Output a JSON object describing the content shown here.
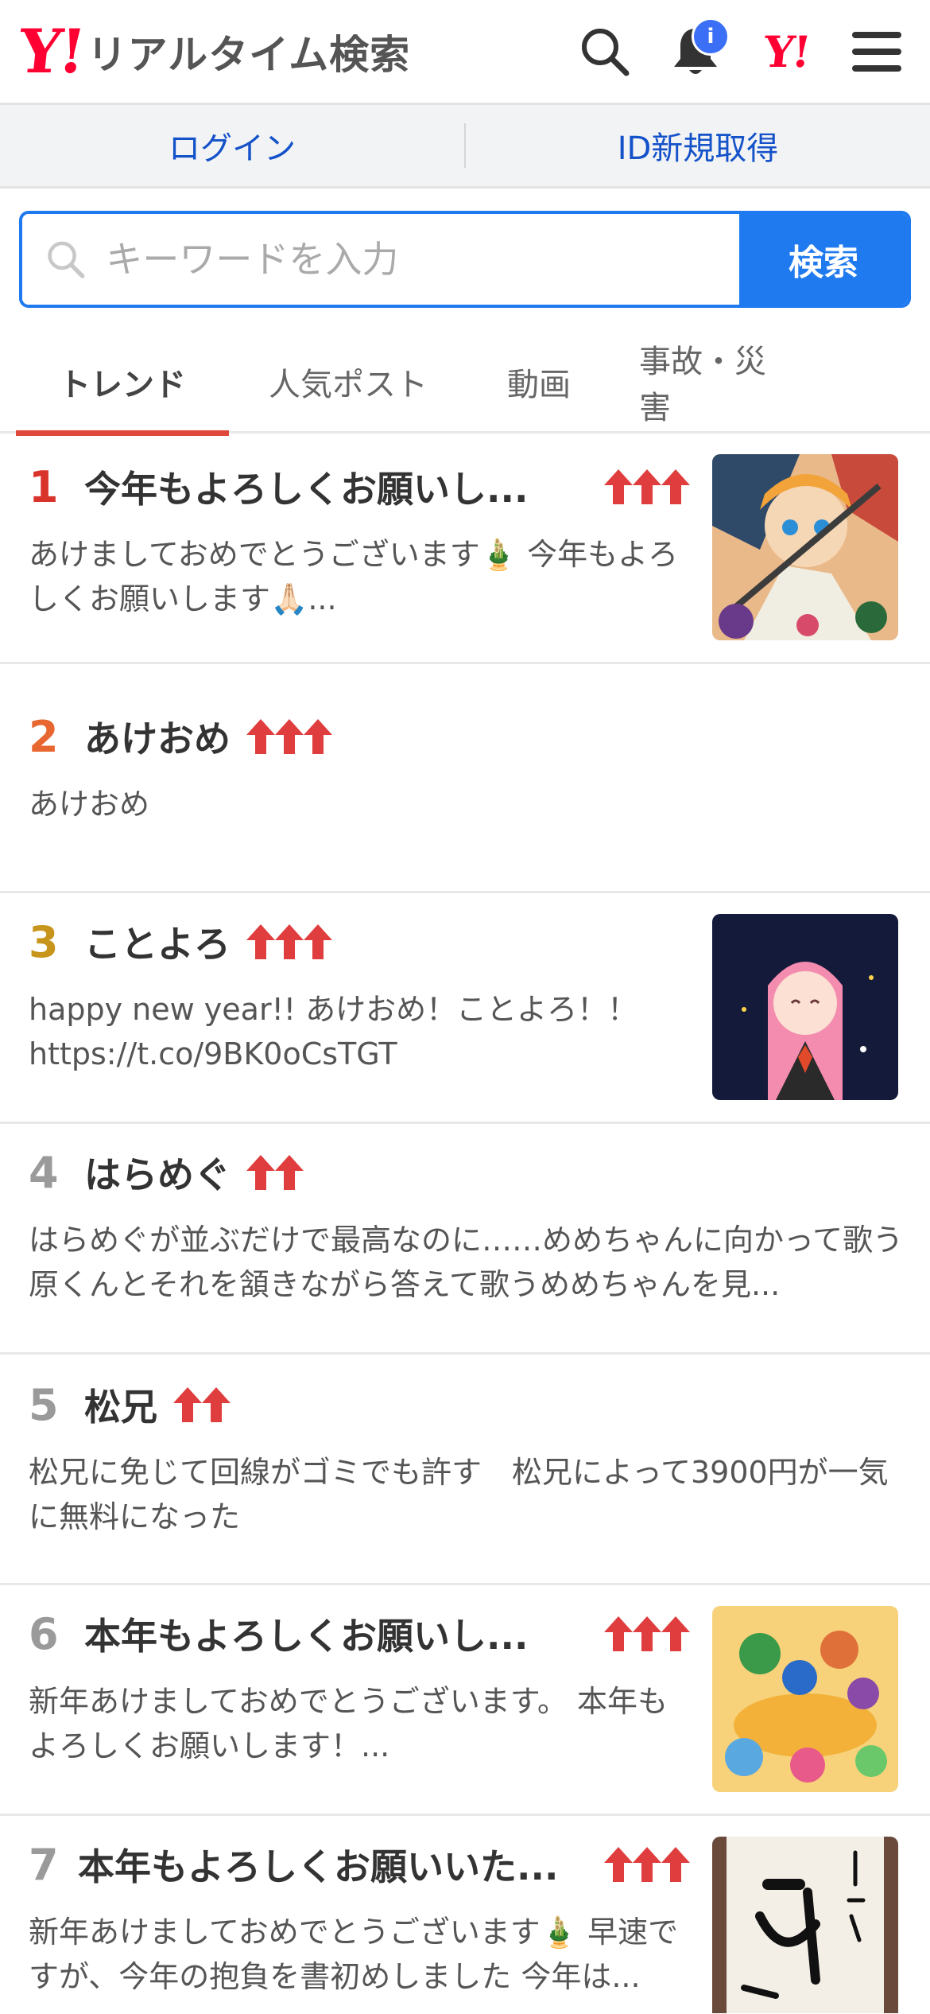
{
  "header": {
    "logo_y": "Y!",
    "logo_text": "リアルタイム検索",
    "notification_badge": "i",
    "yahoo_mini": "Y!"
  },
  "login_bar": {
    "login": "ログイン",
    "signup": "ID新規取得"
  },
  "search": {
    "placeholder": "キーワードを入力",
    "button": "検索"
  },
  "tabs": [
    {
      "label": "トレンド",
      "active": true
    },
    {
      "label": "人気ポスト",
      "active": false
    },
    {
      "label": "動画",
      "active": false
    },
    {
      "label": "事故・災害",
      "active": false
    }
  ],
  "colors": {
    "rank_1": "#d9342b",
    "rank_2": "#e8662f",
    "rank_3": "#c8951c",
    "rank_other": "#9a9a9a",
    "arrow": "#e03e3e",
    "accent_blue": "#1f7af0"
  },
  "trends": [
    {
      "rank": "1",
      "title": "今年もよろしくお願いし...",
      "arrows": 3,
      "desc": "あけましておめでとうございます🎍 今年もよろしくお願いします🙏🏻...",
      "thumb": "anime-illustration"
    },
    {
      "rank": "2",
      "title": "あけおめ",
      "arrows": 3,
      "desc": "あけおめ"
    },
    {
      "rank": "3",
      "title": "ことよろ",
      "arrows": 3,
      "desc": "happy new year!! あけおめ！ことよろ！！ https://t.co/9BK0oCsTGT",
      "thumb": "happy-new-year-illustration"
    },
    {
      "rank": "4",
      "title": "はらめぐ",
      "arrows": 2,
      "desc": "はらめぐが並ぶだけで最高なのに……めめちゃんに向かって歌う原くんとそれを頷きながら答えて歌うめめちゃんを見..."
    },
    {
      "rank": "5",
      "title": "松兄",
      "arrows": 2,
      "desc": "松兄に免じて回線がゴミでも許す　松兄によって3900円が一気に無料になった"
    },
    {
      "rank": "6",
      "title": "本年もよろしくお願いし...",
      "arrows": 3,
      "desc": "新年あけましておめでとうございます。 本年もよろしくお願いします！...",
      "thumb": "cartoon-characters-illustration"
    },
    {
      "rank": "7",
      "title": "本年もよろしくお願いいた...",
      "arrows": 3,
      "desc": "新年あけましておめでとうございます🎍 早速ですが、今年の抱負を書初めしました 今年は...",
      "thumb": "calligraphy-photo"
    }
  ]
}
